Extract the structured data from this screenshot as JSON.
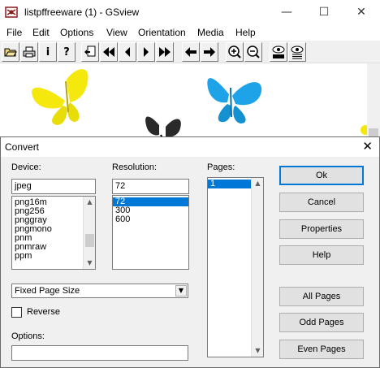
{
  "window": {
    "title": "listpffreeware (1) - GSview",
    "minimize_glyph": "—",
    "maximize_glyph": "☐",
    "close_glyph": "✕"
  },
  "menu": [
    "File",
    "Edit",
    "Options",
    "View",
    "Orientation",
    "Media",
    "Help"
  ],
  "toolbar": {
    "buttons": [
      "open-icon",
      "print-icon",
      "info-icon",
      "help-icon",
      "goto-page-icon",
      "first-page-icon",
      "prev-page-icon",
      "next-page-icon",
      "last-page-icon",
      "back-icon",
      "forward-icon",
      "zoom-in-icon",
      "zoom-out-icon",
      "view-text-icon",
      "view-icon"
    ],
    "info_glyph": "i",
    "help_glyph": "?"
  },
  "dialog": {
    "title": "Convert",
    "close_glyph": "✕",
    "device": {
      "label": "Device:",
      "value": "jpeg",
      "items": [
        "png16m",
        "png256",
        "pnggray",
        "pngmono",
        "pnm",
        "pnmraw",
        "ppm"
      ]
    },
    "resolution": {
      "label": "Resolution:",
      "value": "72",
      "items": [
        "72",
        "300",
        "600"
      ],
      "selected": "72"
    },
    "pages": {
      "label": "Pages:",
      "items": [
        "1"
      ],
      "selected": "1"
    },
    "page_size": {
      "value": "Fixed Page Size"
    },
    "reverse": {
      "label": "Reverse",
      "checked": false
    },
    "options": {
      "label": "Options:",
      "value": ""
    },
    "buttons": {
      "ok": "Ok",
      "cancel": "Cancel",
      "properties": "Properties",
      "help": "Help",
      "all_pages": "All Pages",
      "odd_pages": "Odd Pages",
      "even_pages": "Even Pages"
    }
  },
  "colors": {
    "selection": "#0078d7",
    "butterfly_yellow": "#f5e80c",
    "butterfly_blue": "#1ea3e8",
    "butterfly_dark": "#2a2a2a"
  }
}
